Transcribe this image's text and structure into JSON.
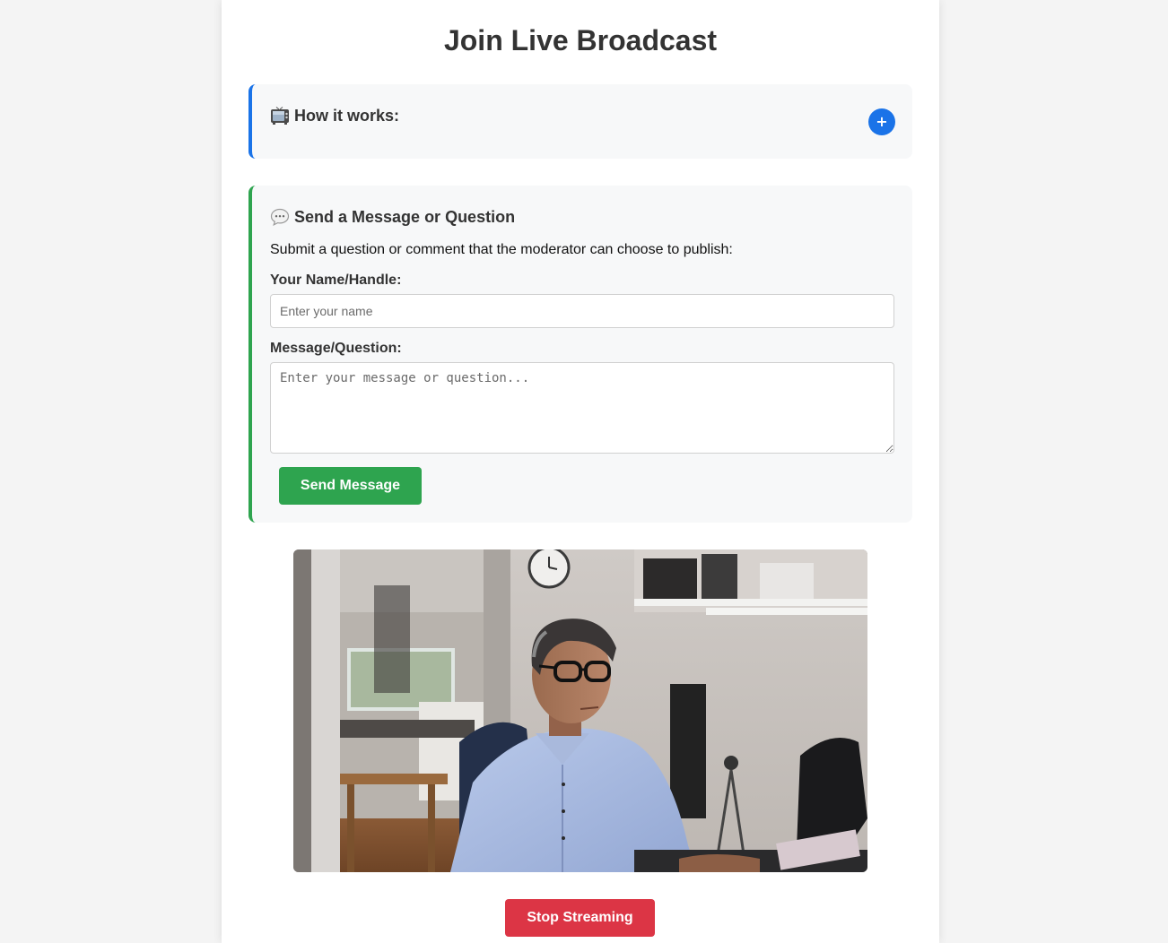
{
  "header": {
    "title": "Join Live Broadcast"
  },
  "how_it_works": {
    "icon": "television-icon",
    "heading": "How it works:",
    "expand_label": "+",
    "accent_color": "#1a73e8"
  },
  "message_panel": {
    "icon": "speech-bubble-icon",
    "heading": "Send a Message or Question",
    "description": "Submit a question or comment that the moderator can choose to publish:",
    "name_label": "Your Name/Handle:",
    "name_value": "",
    "name_placeholder": "Enter your name",
    "message_label": "Message/Question:",
    "message_value": "",
    "message_placeholder": "Enter your message or question...",
    "send_label": "Send Message",
    "accent_color": "#2ea44f"
  },
  "stream": {
    "stop_label": "Stop Streaming",
    "stop_color": "#dc3545"
  }
}
